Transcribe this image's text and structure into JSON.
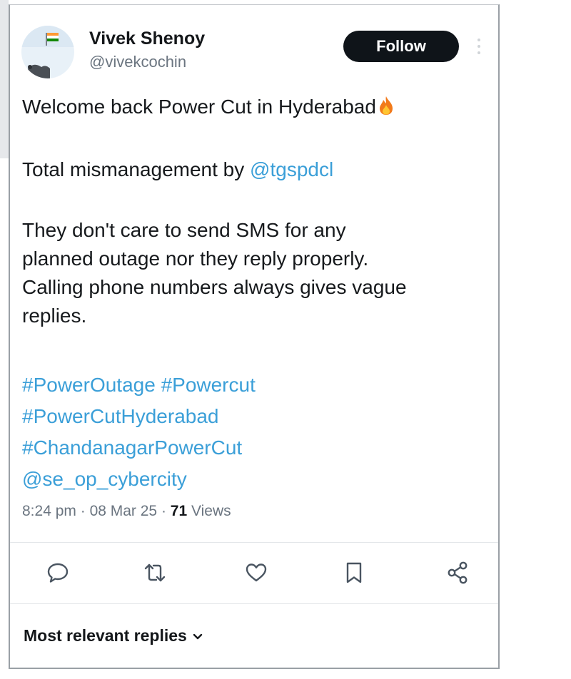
{
  "author": {
    "display_name": "Vivek Shenoy",
    "handle": "@vivekcochin",
    "follow_label": "Follow"
  },
  "tweet": {
    "line1": "Welcome back Power Cut in Hyderabad",
    "line2_prefix": "Total mismanagement by ",
    "line2_mention": "@tgspdcl",
    "body_lines": [
      "They don't care to send SMS for any",
      "planned outage nor they reply properly.",
      "Calling phone numbers always gives vague",
      "replies."
    ],
    "hashtag_lines": [
      "#PowerOutage #Powercut",
      "#PowerCutHyderabad",
      "#ChandanagarPowerCut",
      "@se_op_cybercity"
    ]
  },
  "meta": {
    "time": "8:24 pm",
    "separator": " · ",
    "date": "08 Mar 25",
    "views_count": "71",
    "views_label": " Views"
  },
  "actions": {
    "icons": [
      "reply-icon",
      "retweet-icon",
      "like-icon",
      "bookmark-icon",
      "share-icon"
    ]
  },
  "replies": {
    "sort_label": "Most relevant replies"
  },
  "colors": {
    "link": "#3b9fd8",
    "follow_bg": "#0f1419",
    "muted": "#6b7580",
    "fire": "#f27a1a"
  }
}
